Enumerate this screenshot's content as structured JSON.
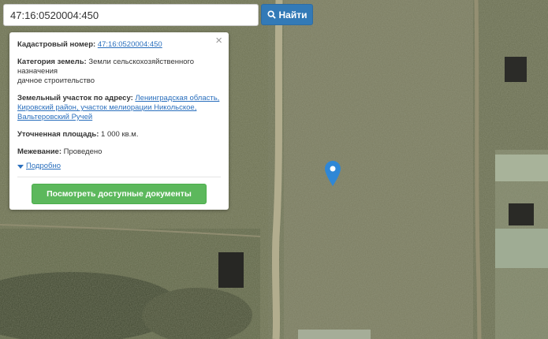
{
  "search": {
    "value": "47:16:0520004:450",
    "button_label": "Найти",
    "icon": "search-icon"
  },
  "popup": {
    "cadastral": {
      "label": "Кадастровый номер:",
      "value": "47:16:0520004:450"
    },
    "category": {
      "label": "Категория земель:",
      "value_line1": "Земли сельскохозяйственного назначения",
      "value_line2": "дачное строительство"
    },
    "address": {
      "label": "Земельный участок по адресу:",
      "value": "Ленинградская область, Кировский район, участок мелиорации Никольское, Вальтеровский Ручей"
    },
    "area": {
      "label": "Уточненная площадь:",
      "value": "1 000 кв.м."
    },
    "survey": {
      "label": "Межевание:",
      "value": "Проведено"
    },
    "more_label": "Подробно",
    "docs_button": "Посмотреть доступные документы",
    "close_symbol": "×"
  },
  "map": {
    "marker_color": "#2f87d6"
  }
}
